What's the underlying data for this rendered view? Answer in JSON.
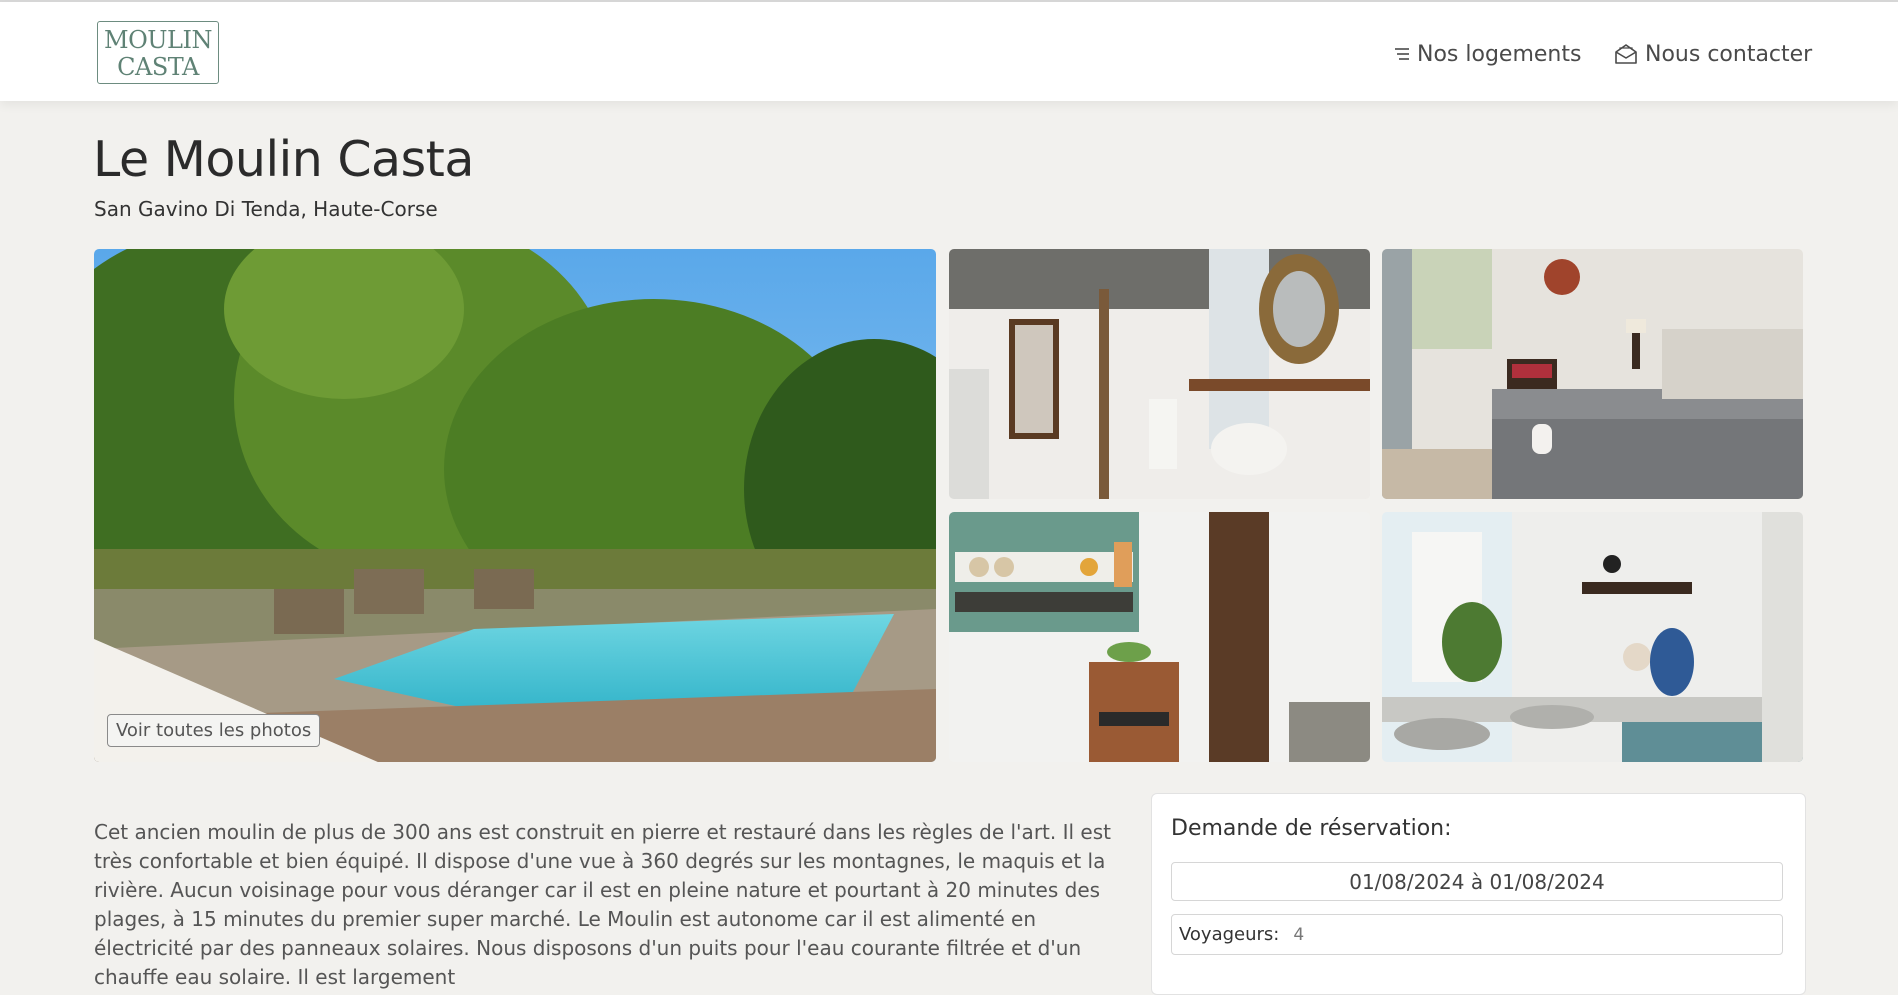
{
  "header": {
    "logo_line1": "MOULIN",
    "logo_line2": "CASTA",
    "nav": [
      {
        "label": "Nos logements",
        "icon": "menu-lines-icon"
      },
      {
        "label": "Nous contacter",
        "icon": "envelope-open-icon"
      }
    ]
  },
  "listing": {
    "title": "Le Moulin Casta",
    "location": "San Gavino Di Tenda, Haute-Corse",
    "photos": [
      {
        "subject": "pool"
      },
      {
        "subject": "bathroom"
      },
      {
        "subject": "bedroom"
      },
      {
        "subject": "kitchen-shelf"
      },
      {
        "subject": "kitchen-sink"
      }
    ],
    "all_photos_button": "Voir toutes les photos",
    "description": "Cet ancien moulin de plus de 300 ans est construit en pierre et restauré dans les règles de l'art. Il est très confortable et bien équipé. Il dispose d'une vue à 360 degrés sur les montagnes, le maquis et la rivière. Aucun voisinage pour vous déranger car il est en pleine nature et pourtant à 20 minutes des plages, à 15 minutes du premier super marché. Le Moulin est autonome car il est alimenté en électricité par des panneaux solaires. Nous disposons d'un puits pour l'eau courante filtrée et d'un chauffe eau solaire. Il est largement"
  },
  "booking": {
    "title": "Demande de réservation:",
    "dates": "01/08/2024 à 01/08/2024",
    "guests_label": "Voyageurs:",
    "guests_value": "4"
  },
  "colors": {
    "background": "#f2f1ee",
    "brand_green": "#5f8275",
    "text": "#333333"
  }
}
